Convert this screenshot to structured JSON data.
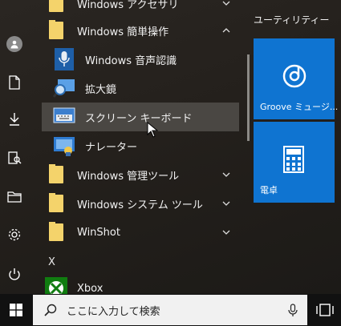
{
  "app_list": {
    "rows": [
      {
        "label": "Windows アクセサリ",
        "kind": "folder",
        "chevron": "chevron-down"
      },
      {
        "label": "Windows 簡単操作",
        "kind": "folder",
        "chevron": "chevron-up"
      },
      {
        "label": "Windows 音声認識",
        "kind": "app",
        "icon": "microphone-icon"
      },
      {
        "label": "拡大鏡",
        "kind": "app",
        "icon": "magnifier-icon"
      },
      {
        "label": "スクリーン キーボード",
        "kind": "app",
        "icon": "keyboard-icon"
      },
      {
        "label": "ナレーター",
        "kind": "app",
        "icon": "narrator-icon"
      },
      {
        "label": "Windows 管理ツール",
        "kind": "folder",
        "chevron": "chevron-down"
      },
      {
        "label": "Windows システム ツール",
        "kind": "folder",
        "chevron": "chevron-down"
      },
      {
        "label": "WinShot",
        "kind": "folder",
        "chevron": "chevron-down"
      }
    ],
    "section_letter": "X",
    "xbox_label": "Xbox"
  },
  "tiles": {
    "group_title": "ユーティリティー",
    "groove_label": "Groove ミュージ...",
    "calc_label": "電卓"
  },
  "taskbar": {
    "search_placeholder": "ここに入力して検索"
  },
  "colors": {
    "tile_blue": "#0f74d1",
    "folder_yellow": "#f4d36b",
    "highlight": "#4a4743"
  }
}
